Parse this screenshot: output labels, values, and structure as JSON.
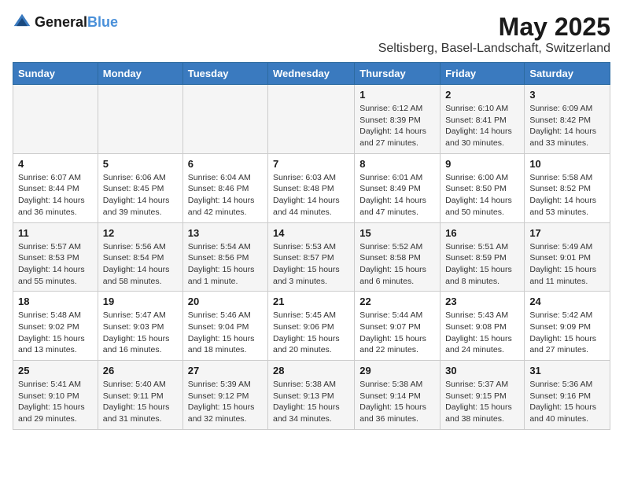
{
  "logo": {
    "general": "General",
    "blue": "Blue"
  },
  "title": "May 2025",
  "subtitle": "Seltisberg, Basel-Landschaft, Switzerland",
  "headers": [
    "Sunday",
    "Monday",
    "Tuesday",
    "Wednesday",
    "Thursday",
    "Friday",
    "Saturday"
  ],
  "weeks": [
    [
      {
        "day": "",
        "info": ""
      },
      {
        "day": "",
        "info": ""
      },
      {
        "day": "",
        "info": ""
      },
      {
        "day": "",
        "info": ""
      },
      {
        "day": "1",
        "info": "Sunrise: 6:12 AM\nSunset: 8:39 PM\nDaylight: 14 hours\nand 27 minutes."
      },
      {
        "day": "2",
        "info": "Sunrise: 6:10 AM\nSunset: 8:41 PM\nDaylight: 14 hours\nand 30 minutes."
      },
      {
        "day": "3",
        "info": "Sunrise: 6:09 AM\nSunset: 8:42 PM\nDaylight: 14 hours\nand 33 minutes."
      }
    ],
    [
      {
        "day": "4",
        "info": "Sunrise: 6:07 AM\nSunset: 8:44 PM\nDaylight: 14 hours\nand 36 minutes."
      },
      {
        "day": "5",
        "info": "Sunrise: 6:06 AM\nSunset: 8:45 PM\nDaylight: 14 hours\nand 39 minutes."
      },
      {
        "day": "6",
        "info": "Sunrise: 6:04 AM\nSunset: 8:46 PM\nDaylight: 14 hours\nand 42 minutes."
      },
      {
        "day": "7",
        "info": "Sunrise: 6:03 AM\nSunset: 8:48 PM\nDaylight: 14 hours\nand 44 minutes."
      },
      {
        "day": "8",
        "info": "Sunrise: 6:01 AM\nSunset: 8:49 PM\nDaylight: 14 hours\nand 47 minutes."
      },
      {
        "day": "9",
        "info": "Sunrise: 6:00 AM\nSunset: 8:50 PM\nDaylight: 14 hours\nand 50 minutes."
      },
      {
        "day": "10",
        "info": "Sunrise: 5:58 AM\nSunset: 8:52 PM\nDaylight: 14 hours\nand 53 minutes."
      }
    ],
    [
      {
        "day": "11",
        "info": "Sunrise: 5:57 AM\nSunset: 8:53 PM\nDaylight: 14 hours\nand 55 minutes."
      },
      {
        "day": "12",
        "info": "Sunrise: 5:56 AM\nSunset: 8:54 PM\nDaylight: 14 hours\nand 58 minutes."
      },
      {
        "day": "13",
        "info": "Sunrise: 5:54 AM\nSunset: 8:56 PM\nDaylight: 15 hours\nand 1 minute."
      },
      {
        "day": "14",
        "info": "Sunrise: 5:53 AM\nSunset: 8:57 PM\nDaylight: 15 hours\nand 3 minutes."
      },
      {
        "day": "15",
        "info": "Sunrise: 5:52 AM\nSunset: 8:58 PM\nDaylight: 15 hours\nand 6 minutes."
      },
      {
        "day": "16",
        "info": "Sunrise: 5:51 AM\nSunset: 8:59 PM\nDaylight: 15 hours\nand 8 minutes."
      },
      {
        "day": "17",
        "info": "Sunrise: 5:49 AM\nSunset: 9:01 PM\nDaylight: 15 hours\nand 11 minutes."
      }
    ],
    [
      {
        "day": "18",
        "info": "Sunrise: 5:48 AM\nSunset: 9:02 PM\nDaylight: 15 hours\nand 13 minutes."
      },
      {
        "day": "19",
        "info": "Sunrise: 5:47 AM\nSunset: 9:03 PM\nDaylight: 15 hours\nand 16 minutes."
      },
      {
        "day": "20",
        "info": "Sunrise: 5:46 AM\nSunset: 9:04 PM\nDaylight: 15 hours\nand 18 minutes."
      },
      {
        "day": "21",
        "info": "Sunrise: 5:45 AM\nSunset: 9:06 PM\nDaylight: 15 hours\nand 20 minutes."
      },
      {
        "day": "22",
        "info": "Sunrise: 5:44 AM\nSunset: 9:07 PM\nDaylight: 15 hours\nand 22 minutes."
      },
      {
        "day": "23",
        "info": "Sunrise: 5:43 AM\nSunset: 9:08 PM\nDaylight: 15 hours\nand 24 minutes."
      },
      {
        "day": "24",
        "info": "Sunrise: 5:42 AM\nSunset: 9:09 PM\nDaylight: 15 hours\nand 27 minutes."
      }
    ],
    [
      {
        "day": "25",
        "info": "Sunrise: 5:41 AM\nSunset: 9:10 PM\nDaylight: 15 hours\nand 29 minutes."
      },
      {
        "day": "26",
        "info": "Sunrise: 5:40 AM\nSunset: 9:11 PM\nDaylight: 15 hours\nand 31 minutes."
      },
      {
        "day": "27",
        "info": "Sunrise: 5:39 AM\nSunset: 9:12 PM\nDaylight: 15 hours\nand 32 minutes."
      },
      {
        "day": "28",
        "info": "Sunrise: 5:38 AM\nSunset: 9:13 PM\nDaylight: 15 hours\nand 34 minutes."
      },
      {
        "day": "29",
        "info": "Sunrise: 5:38 AM\nSunset: 9:14 PM\nDaylight: 15 hours\nand 36 minutes."
      },
      {
        "day": "30",
        "info": "Sunrise: 5:37 AM\nSunset: 9:15 PM\nDaylight: 15 hours\nand 38 minutes."
      },
      {
        "day": "31",
        "info": "Sunrise: 5:36 AM\nSunset: 9:16 PM\nDaylight: 15 hours\nand 40 minutes."
      }
    ]
  ]
}
